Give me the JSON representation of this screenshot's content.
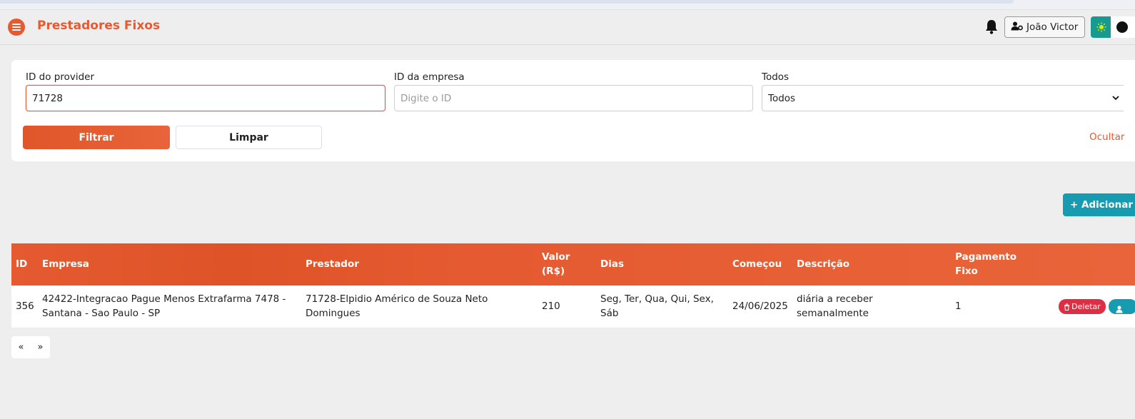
{
  "header": {
    "title": "Prestadores Fixos",
    "user_name": "João Victor"
  },
  "filters": {
    "provider_label": "ID do provider",
    "provider_value": "71728",
    "company_label": "ID da empresa",
    "company_placeholder": "Digite o ID",
    "status_label": "Todos",
    "status_selected": "Todos",
    "filter_button": "Filtrar",
    "clear_button": "Limpar",
    "hide_link": "Ocultar"
  },
  "actions": {
    "add_button": "+ Adicionar"
  },
  "table": {
    "headers": {
      "id": "ID",
      "empresa": "Empresa",
      "prestador": "Prestador",
      "valor": "Valor (R$)",
      "dias": "Dias",
      "comecou": "Começou",
      "descricao": "Descrição",
      "pagamento": "Pagamento Fixo"
    },
    "rows": [
      {
        "id": "356",
        "empresa": "42422-Integracao Pague Menos Extrafarma 7478 - Santana - Sao Paulo - SP",
        "prestador": "71728-Elpidio Américo de Souza Neto Domingues",
        "valor": "210",
        "dias": "Seg, Ter, Qua, Qui, Sex, Sáb",
        "comecou": "24/06/2025",
        "descricao": "diária a receber semanalmente",
        "pagamento": "1",
        "delete_label": "Deletar"
      }
    ]
  },
  "pagination": {
    "prev": "«",
    "next": "»"
  },
  "colors": {
    "accent": "#e55a30",
    "teal": "#169bb0",
    "danger": "#dc2f44"
  }
}
